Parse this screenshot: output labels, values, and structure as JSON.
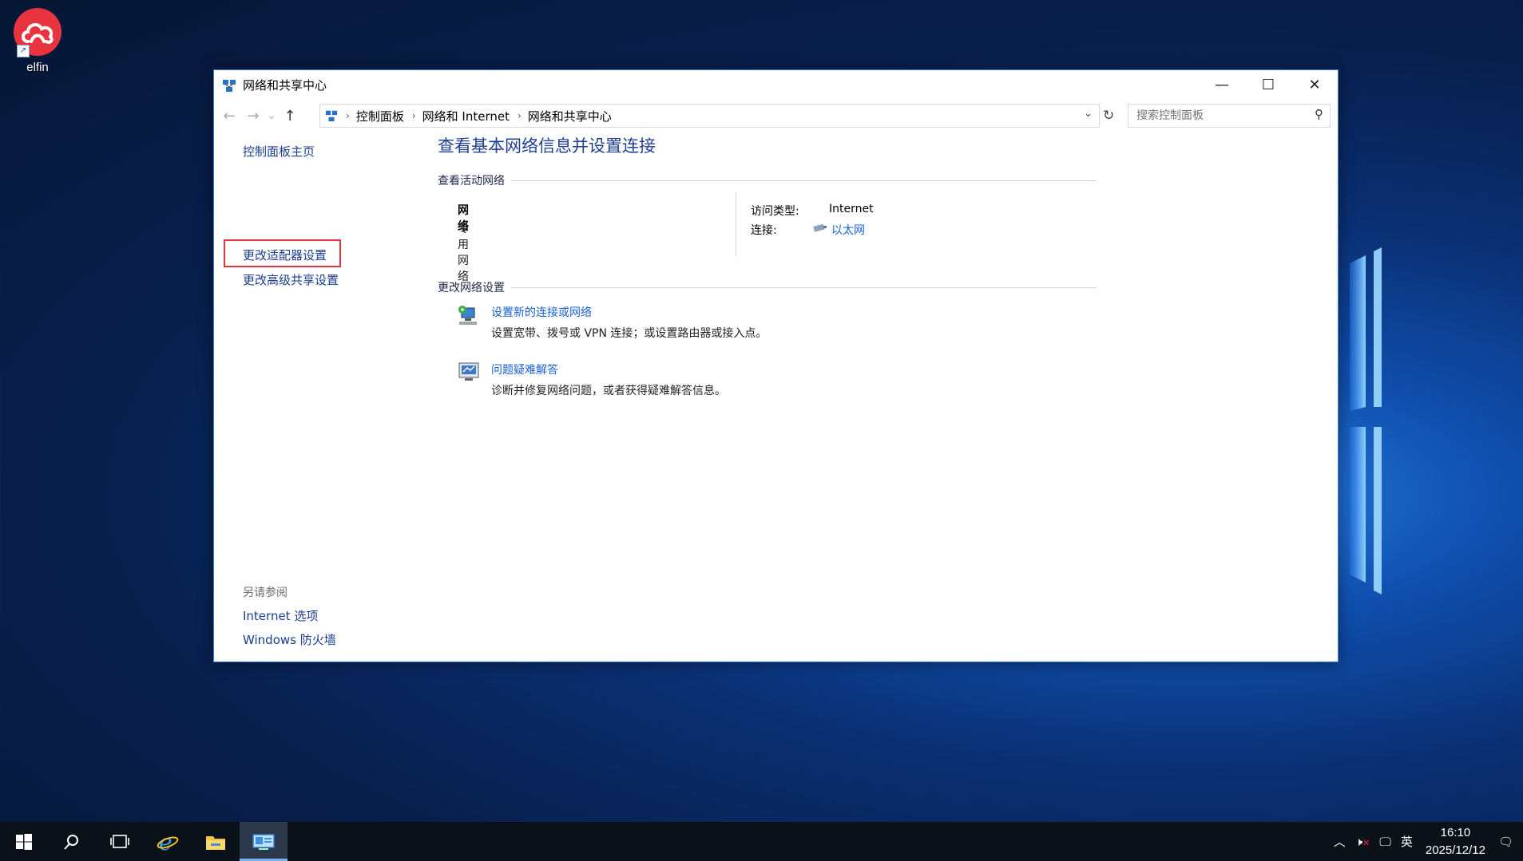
{
  "desktop": {
    "icon_label": "elfin"
  },
  "window": {
    "title": "网络和共享中心",
    "controls": {
      "minimize": "—",
      "maximize": "☐",
      "close": "✕"
    },
    "breadcrumb": [
      "控制面板",
      "网络和 Internet",
      "网络和共享中心"
    ],
    "search_placeholder": "搜索控制面板"
  },
  "sidebar": {
    "items": [
      {
        "label": "控制面板主页"
      },
      {
        "label": "更改适配器设置"
      },
      {
        "label": "更改高级共享设置"
      }
    ],
    "see_also_title": "另请参阅",
    "see_also": [
      {
        "label": "Internet 选项"
      },
      {
        "label": "Windows 防火墙"
      }
    ]
  },
  "main": {
    "heading": "查看基本网络信息并设置连接",
    "active_networks_title": "查看活动网络",
    "network_name": "网络",
    "network_type": "专用网络",
    "access_type_label": "访问类型:",
    "access_type_value": "Internet",
    "connection_label": "连接:",
    "connection_value": "以太网",
    "change_settings_title": "更改网络设置",
    "tasks": [
      {
        "title": "设置新的连接或网络",
        "desc": "设置宽带、拨号或 VPN 连接；或设置路由器或接入点。"
      },
      {
        "title": "问题疑难解答",
        "desc": "诊断并修复网络问题，或者获得疑难解答信息。"
      }
    ]
  },
  "taskbar": {
    "ime": "英",
    "time": "16:10",
    "date": "2025/12/12"
  }
}
